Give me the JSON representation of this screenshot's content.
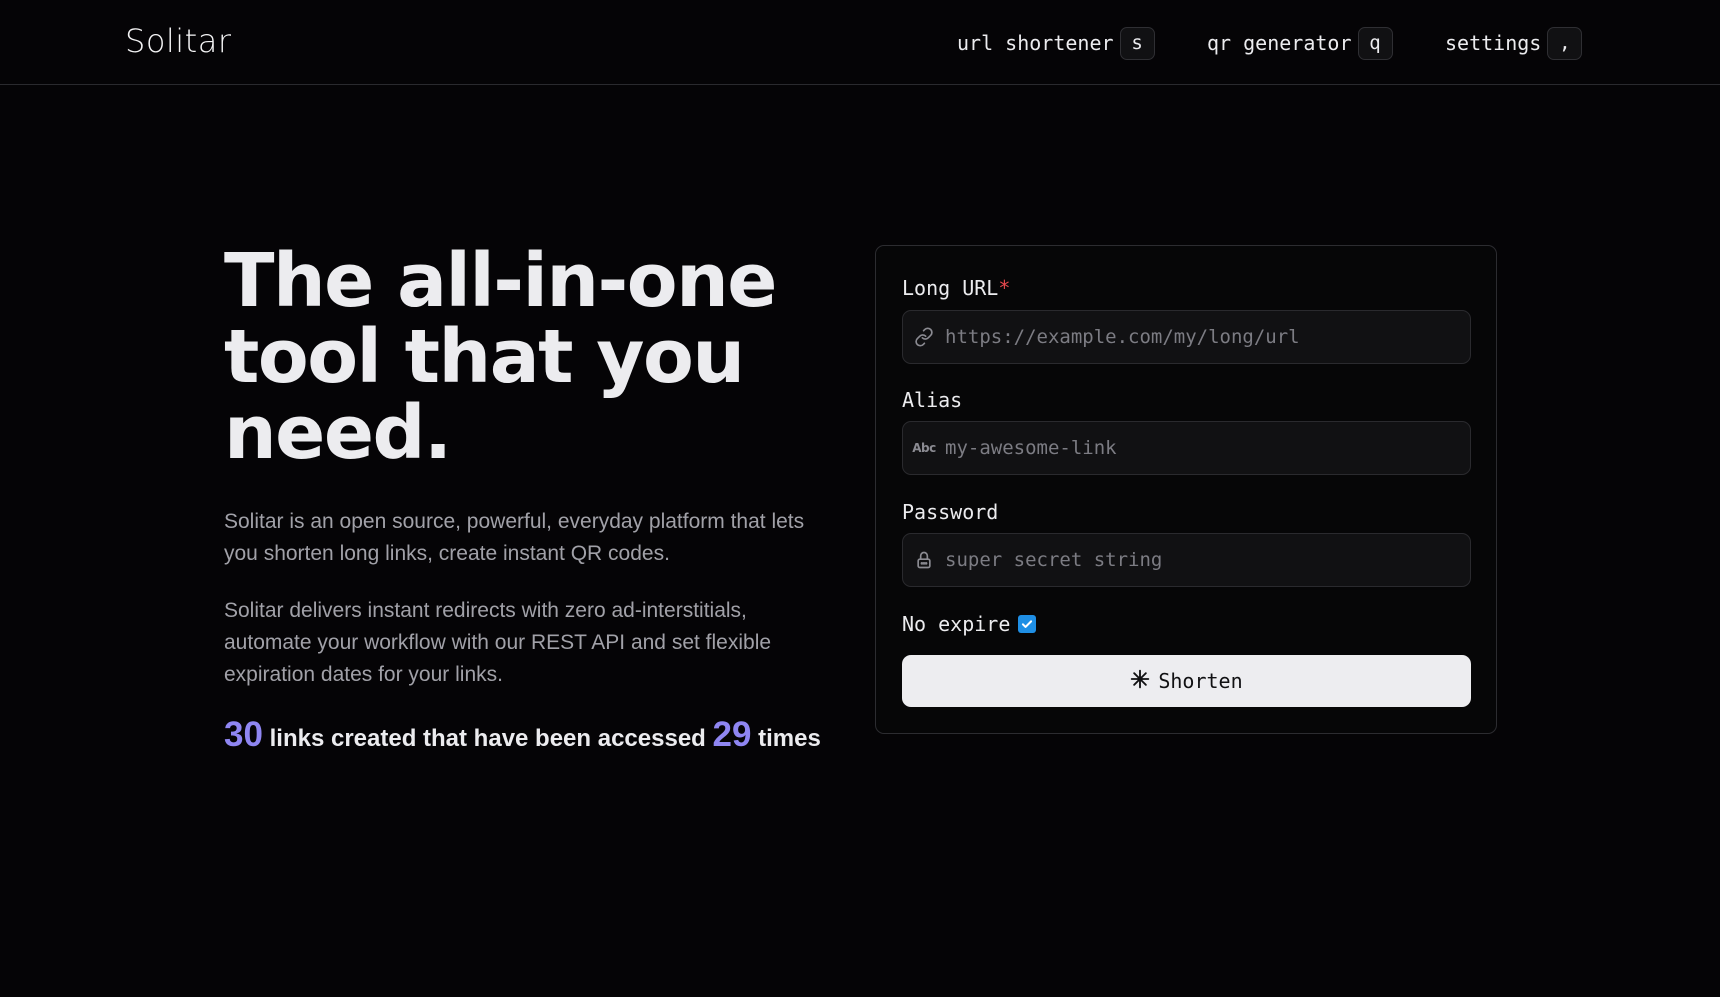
{
  "header": {
    "logo": "Solitar",
    "nav": [
      {
        "label": "url shortener",
        "key": "s"
      },
      {
        "label": "qr generator",
        "key": "q"
      },
      {
        "label": "settings",
        "key": ","
      }
    ]
  },
  "hero": {
    "title": "The all-in-one tool that you need.",
    "description_1": "Solitar is an open source, powerful, everyday platform that lets you shorten long links, create instant QR codes.",
    "description_2": "Solitar delivers instant redirects with zero ad-interstitials, automate your workflow with our REST API and set flexible expiration dates for your links.",
    "stats": {
      "links_created": "30",
      "text_middle": "links created that have been accessed",
      "times_accessed": "29",
      "text_end": "times"
    }
  },
  "form": {
    "long_url": {
      "label": "Long URL",
      "required_mark": "*",
      "placeholder": "https://example.com/my/long/url",
      "value": "",
      "icon": "link-icon"
    },
    "alias": {
      "label": "Alias",
      "placeholder": "my-awesome-link",
      "value": "",
      "icon": "abc-icon",
      "icon_text": "Abc"
    },
    "password": {
      "label": "Password",
      "placeholder": "super secret string",
      "value": "",
      "icon": "lock-icon"
    },
    "no_expire": {
      "label": "No expire",
      "checked": true
    },
    "submit": {
      "label": "Shorten",
      "icon": "sparkle-icon"
    }
  },
  "colors": {
    "background": "#050406",
    "accent": "#8f86f2",
    "required": "#e5484d",
    "checkbox": "#1f8fe5",
    "button_bg": "#ededf0"
  }
}
